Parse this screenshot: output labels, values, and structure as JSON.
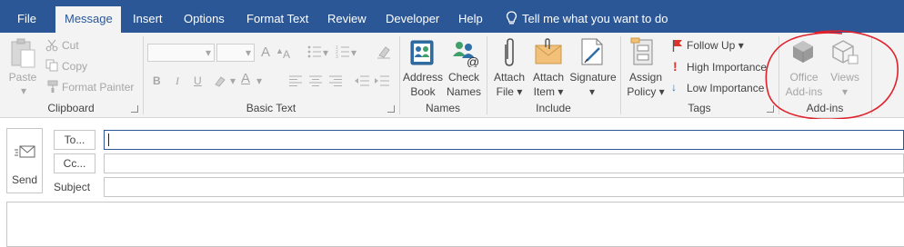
{
  "tabs": [
    "File",
    "Message",
    "Insert",
    "Options",
    "Format Text",
    "Review",
    "Developer",
    "Help"
  ],
  "active_tab": "Message",
  "tell_me": "Tell me what you want to do",
  "clipboard": {
    "paste": "Paste",
    "cut": "Cut",
    "copy": "Copy",
    "format_painter": "Format Painter",
    "group_label": "Clipboard"
  },
  "basic_text": {
    "bold": "B",
    "italic": "I",
    "underline": "U",
    "font_color": "A",
    "grow_font": "A",
    "group_label": "Basic Text"
  },
  "names": {
    "address_book_1": "Address",
    "address_book_2": "Book",
    "check_names_1": "Check",
    "check_names_2": "Names",
    "group_label": "Names"
  },
  "include": {
    "attach_file_1": "Attach",
    "attach_file_2": "File",
    "attach_item_1": "Attach",
    "attach_item_2": "Item",
    "signature": "Signature",
    "group_label": "Include"
  },
  "tags": {
    "assign_policy_1": "Assign",
    "assign_policy_2": "Policy",
    "follow_up": "Follow Up",
    "high_importance": "High Importance",
    "low_importance": "Low Importance",
    "group_label": "Tags"
  },
  "addins": {
    "office_addins_1": "Office",
    "office_addins_2": "Add-ins",
    "views": "Views",
    "group_label": "Add-ins"
  },
  "form": {
    "send": "Send",
    "to": "To...",
    "cc": "Cc...",
    "subject": "Subject"
  },
  "colors": {
    "title_bar": "#2b5797",
    "ribbon": "#f3f3f3",
    "annotation": "#e0202a"
  }
}
